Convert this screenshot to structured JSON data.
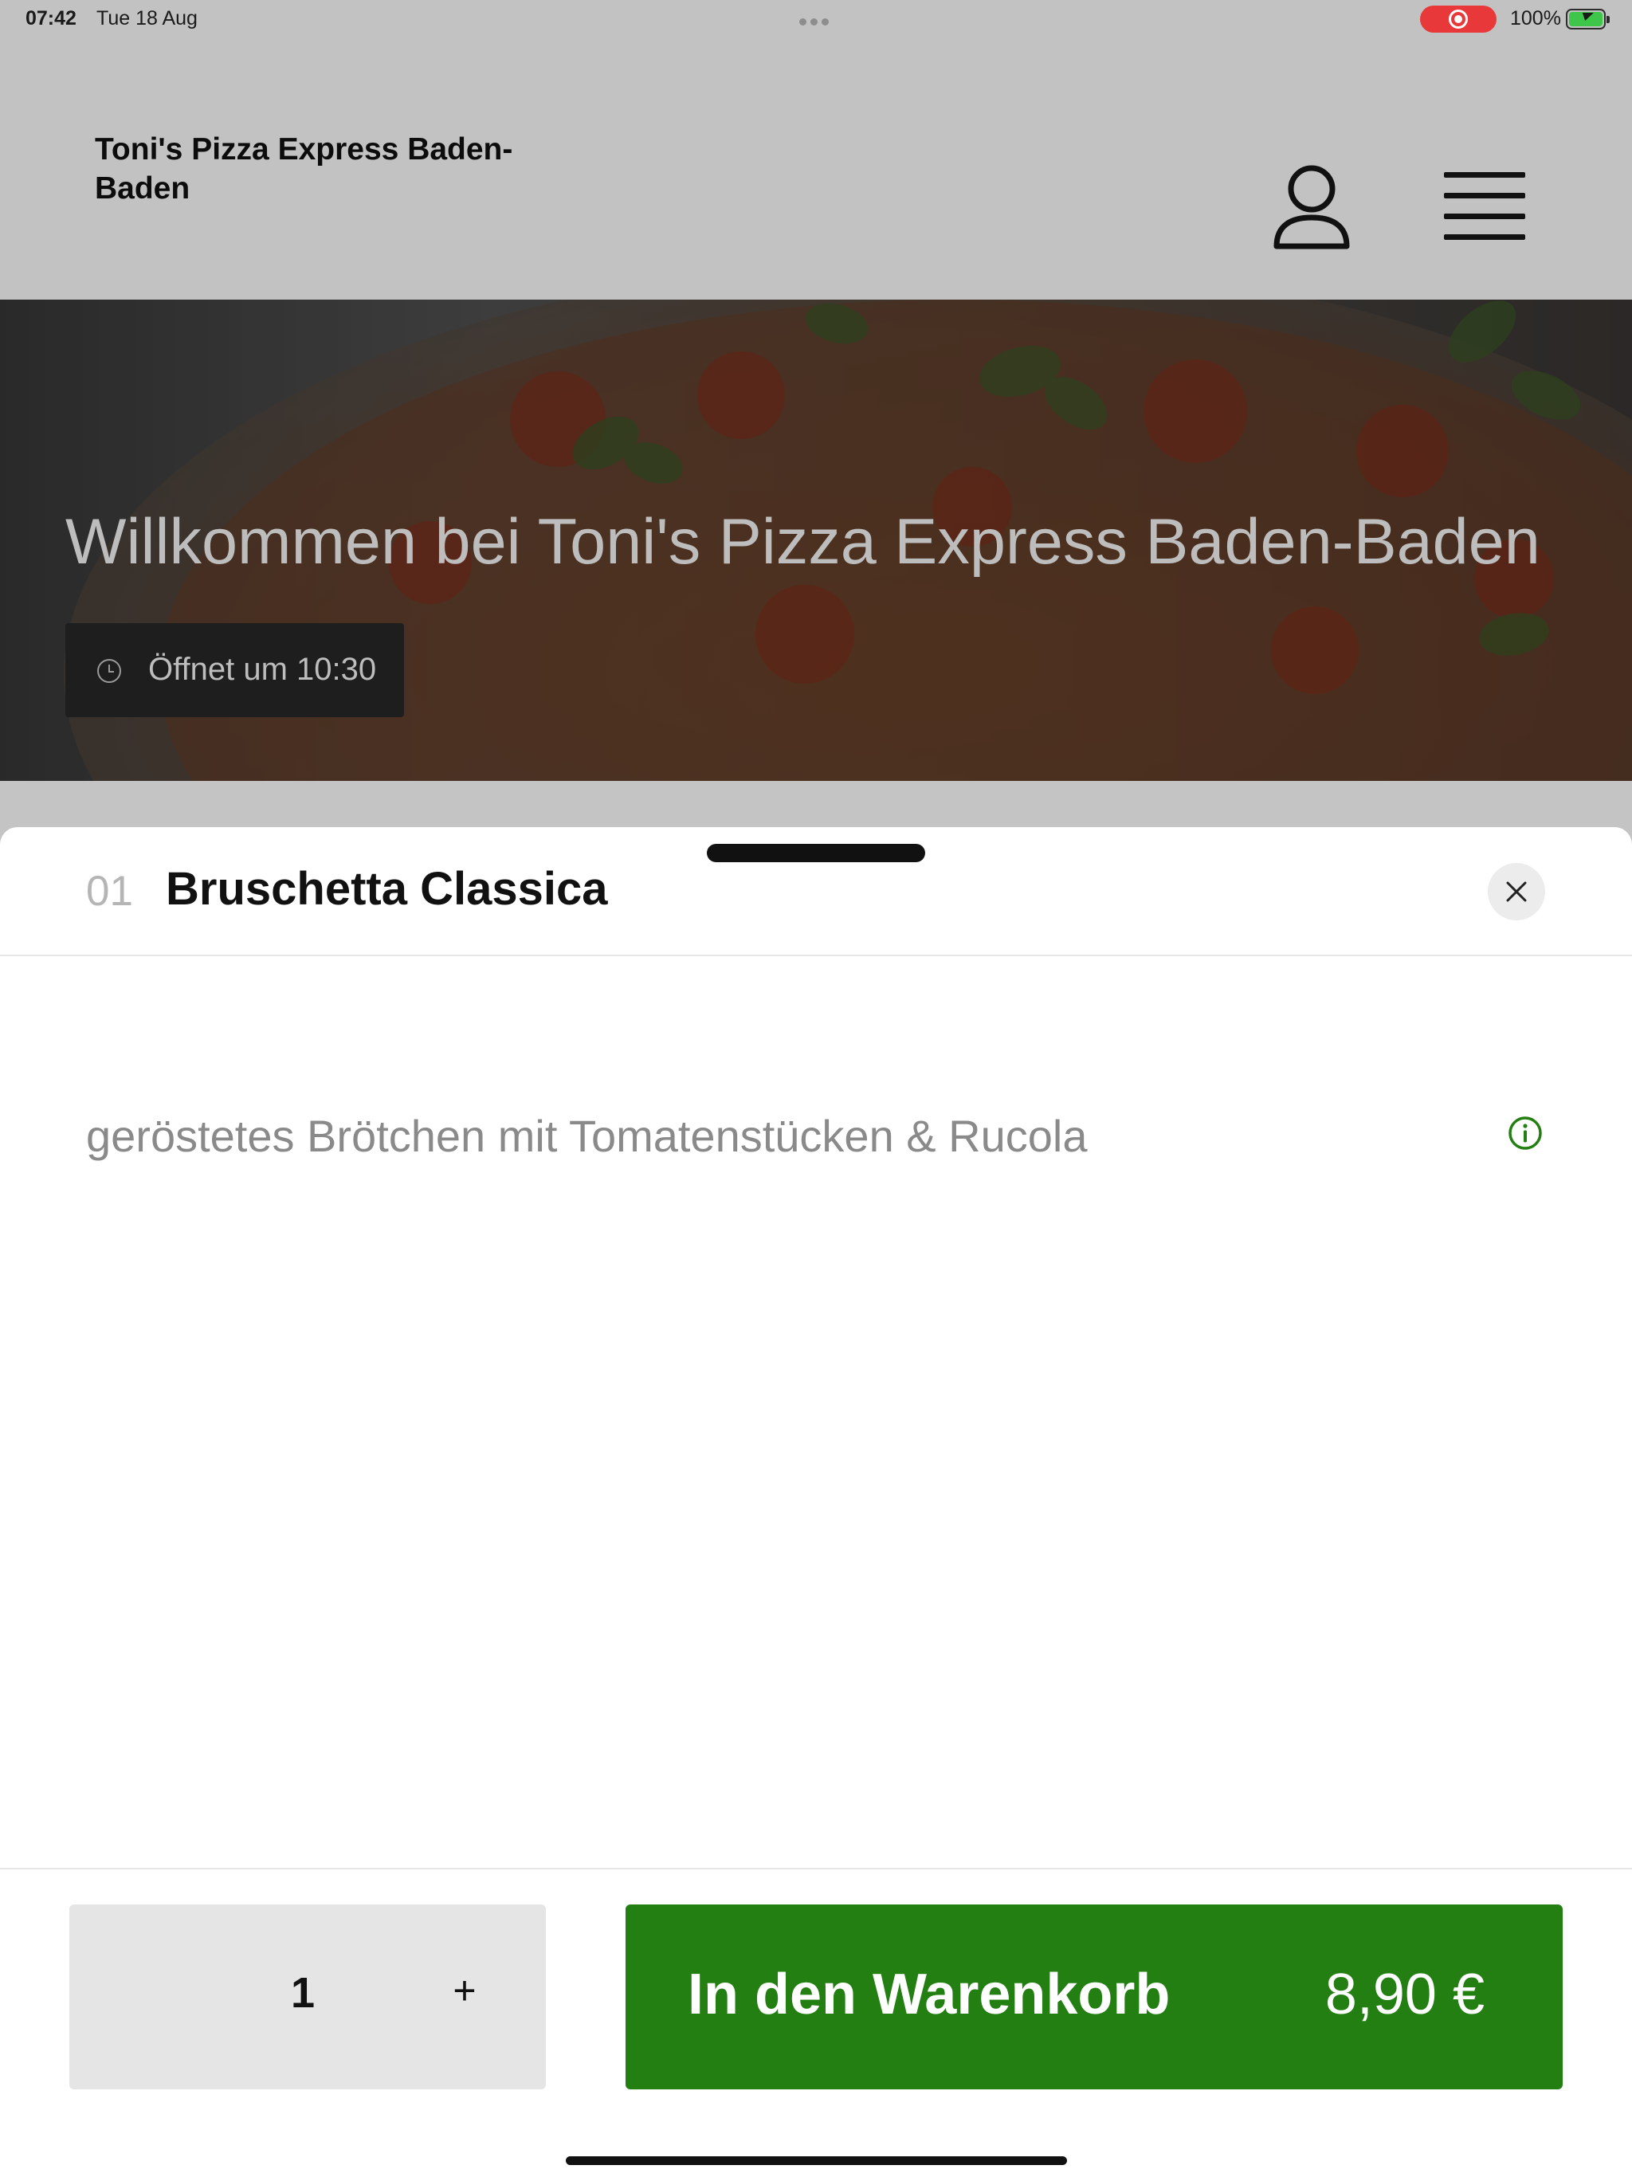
{
  "status_bar": {
    "time": "07:42",
    "date": "Tue 18 Aug",
    "battery_percent": "100%",
    "recording": true,
    "battery_color": "#3ec64a",
    "record_color": "#e8383a"
  },
  "header": {
    "brand": "Toni's Pizza Express Baden-Baden",
    "icons": [
      "user-icon",
      "hamburger-menu-icon"
    ]
  },
  "hero": {
    "title": "Willkommen bei Toni's Pizza Express Baden-Baden",
    "opening": "Öffnet um 10:30",
    "icon": "clock-icon"
  },
  "item_sheet": {
    "number": "01",
    "name": "Bruschetta Classica",
    "description": "geröstetes Brötchen mit Tomatenstücken & Rucola",
    "info_icon": "info-icon",
    "close_icon": "close-icon"
  },
  "footer": {
    "quantity": "1",
    "plus_label": "+",
    "add_to_cart_label": "In den Warenkorb",
    "price": "8,90 €",
    "accent_color": "#237f12"
  }
}
